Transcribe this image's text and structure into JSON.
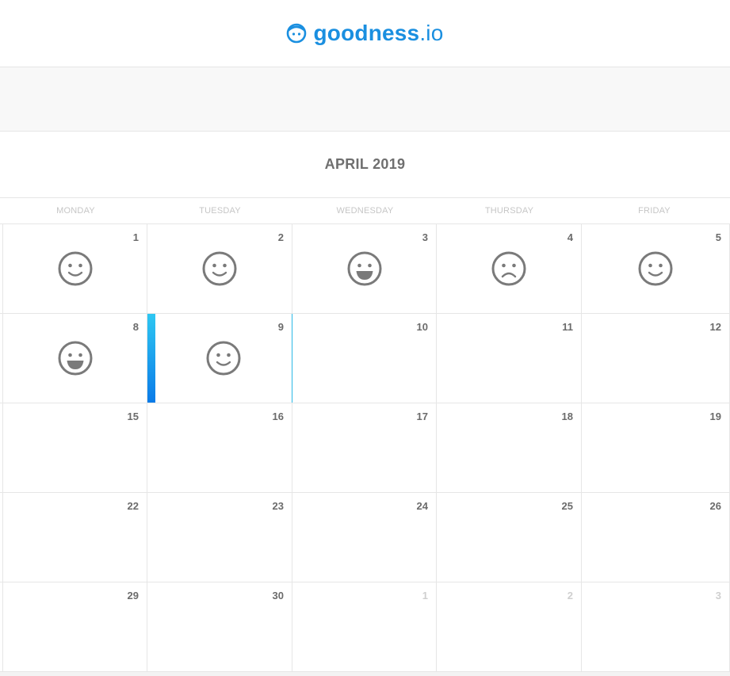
{
  "header": {
    "logo_word": "goodness",
    "logo_suffix": ".io",
    "logo_icon": "face-logo-icon"
  },
  "calendar": {
    "month_title": "APRIL 2019",
    "weekdays": [
      "MONDAY",
      "TUESDAY",
      "WEDNESDAY",
      "THURSDAY",
      "FRIDAY"
    ],
    "weeks": [
      [
        {
          "day": "1",
          "mood": "smile"
        },
        {
          "day": "2",
          "mood": "smile"
        },
        {
          "day": "3",
          "mood": "grin"
        },
        {
          "day": "4",
          "mood": "frown"
        },
        {
          "day": "5",
          "mood": "smile"
        }
      ],
      [
        {
          "day": "8",
          "mood": "grin"
        },
        {
          "day": "9",
          "mood": "smile",
          "today": true
        },
        {
          "day": "10"
        },
        {
          "day": "11"
        },
        {
          "day": "12"
        }
      ],
      [
        {
          "day": "15"
        },
        {
          "day": "16"
        },
        {
          "day": "17"
        },
        {
          "day": "18"
        },
        {
          "day": "19"
        }
      ],
      [
        {
          "day": "22"
        },
        {
          "day": "23"
        },
        {
          "day": "24"
        },
        {
          "day": "25"
        },
        {
          "day": "26"
        }
      ],
      [
        {
          "day": "29"
        },
        {
          "day": "30"
        },
        {
          "day": "1",
          "other_month": true
        },
        {
          "day": "2",
          "other_month": true
        },
        {
          "day": "3",
          "other_month": true
        }
      ]
    ]
  },
  "colors": {
    "brand": "#1a8fe0",
    "mood_icon": "#7a7a7a",
    "today_gradient_top": "#2ec7f2",
    "today_gradient_bottom": "#0a7be8"
  }
}
